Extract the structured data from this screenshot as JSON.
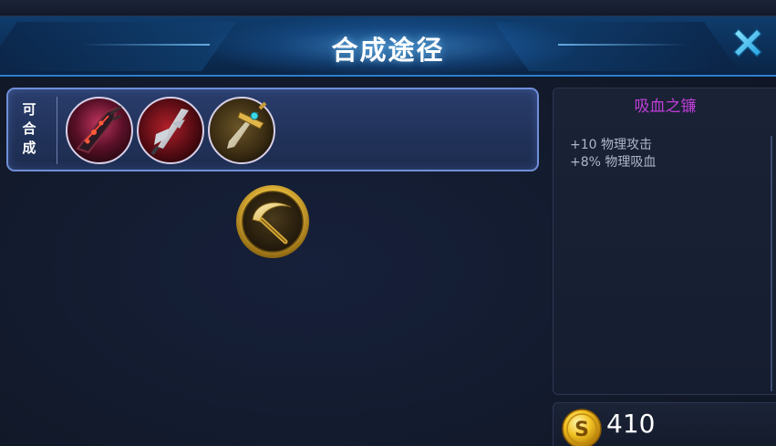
{
  "top_strip": {
    "ghost_text": ""
  },
  "header": {
    "title": "合成途径"
  },
  "compose": {
    "label_chars": [
      "可",
      "合",
      "成"
    ],
    "items": [
      {
        "icon": "dark-crimson-blade-icon"
      },
      {
        "icon": "red-silver-sword-icon"
      },
      {
        "icon": "golden-hilt-sword-icon"
      }
    ]
  },
  "center_item": {
    "icon": "golden-sickle-icon"
  },
  "detail": {
    "name": "吸血之镰",
    "stats": [
      "+10 物理攻击",
      "+8% 物理吸血"
    ]
  },
  "price": {
    "icon": "gold-coin-icon",
    "value": "410"
  },
  "colors": {
    "item_name": "#c03ed8",
    "header_bg": "#0f3c6c",
    "panel_border": "#6f8fd8",
    "close_cyan": "#3fc0f0"
  }
}
